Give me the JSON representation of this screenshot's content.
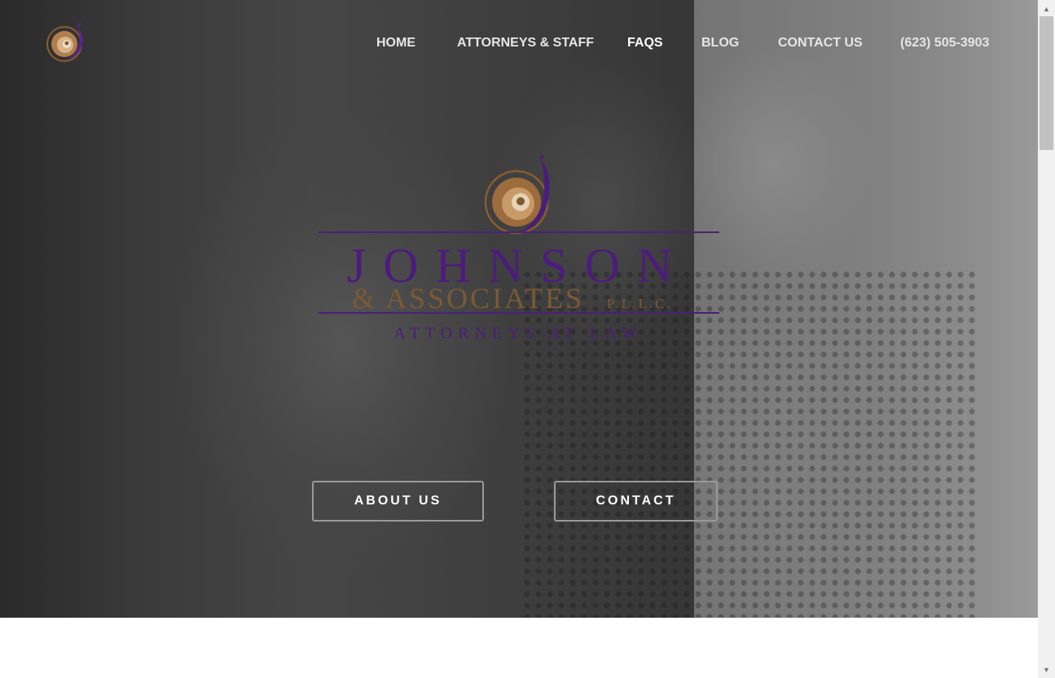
{
  "nav": {
    "logo_icon": "swirl-logo-icon",
    "items": [
      {
        "label": "HOME",
        "active": false
      },
      {
        "label": "ATTORNEYS & STAFF",
        "active": false
      },
      {
        "label": "FAQS",
        "active": true
      },
      {
        "label": "BLOG",
        "active": false
      },
      {
        "label": "CONTACT US",
        "active": false
      },
      {
        "label": "(623) 505-3903",
        "active": false
      }
    ]
  },
  "brand": {
    "icon": "swirl-logo-icon",
    "name": "JOHNSON",
    "associates": "& ASSOCIATES",
    "suffix": "P.L.L.C.",
    "tagline": "ATTORNEYS AT LAW"
  },
  "hero": {
    "about_button": "ABOUT US",
    "contact_button": "CONTACT"
  },
  "colors": {
    "brand_purple": "#4c1c7c",
    "brand_bronze": "#7a5a34",
    "nav_text": "#e6e6e6"
  }
}
